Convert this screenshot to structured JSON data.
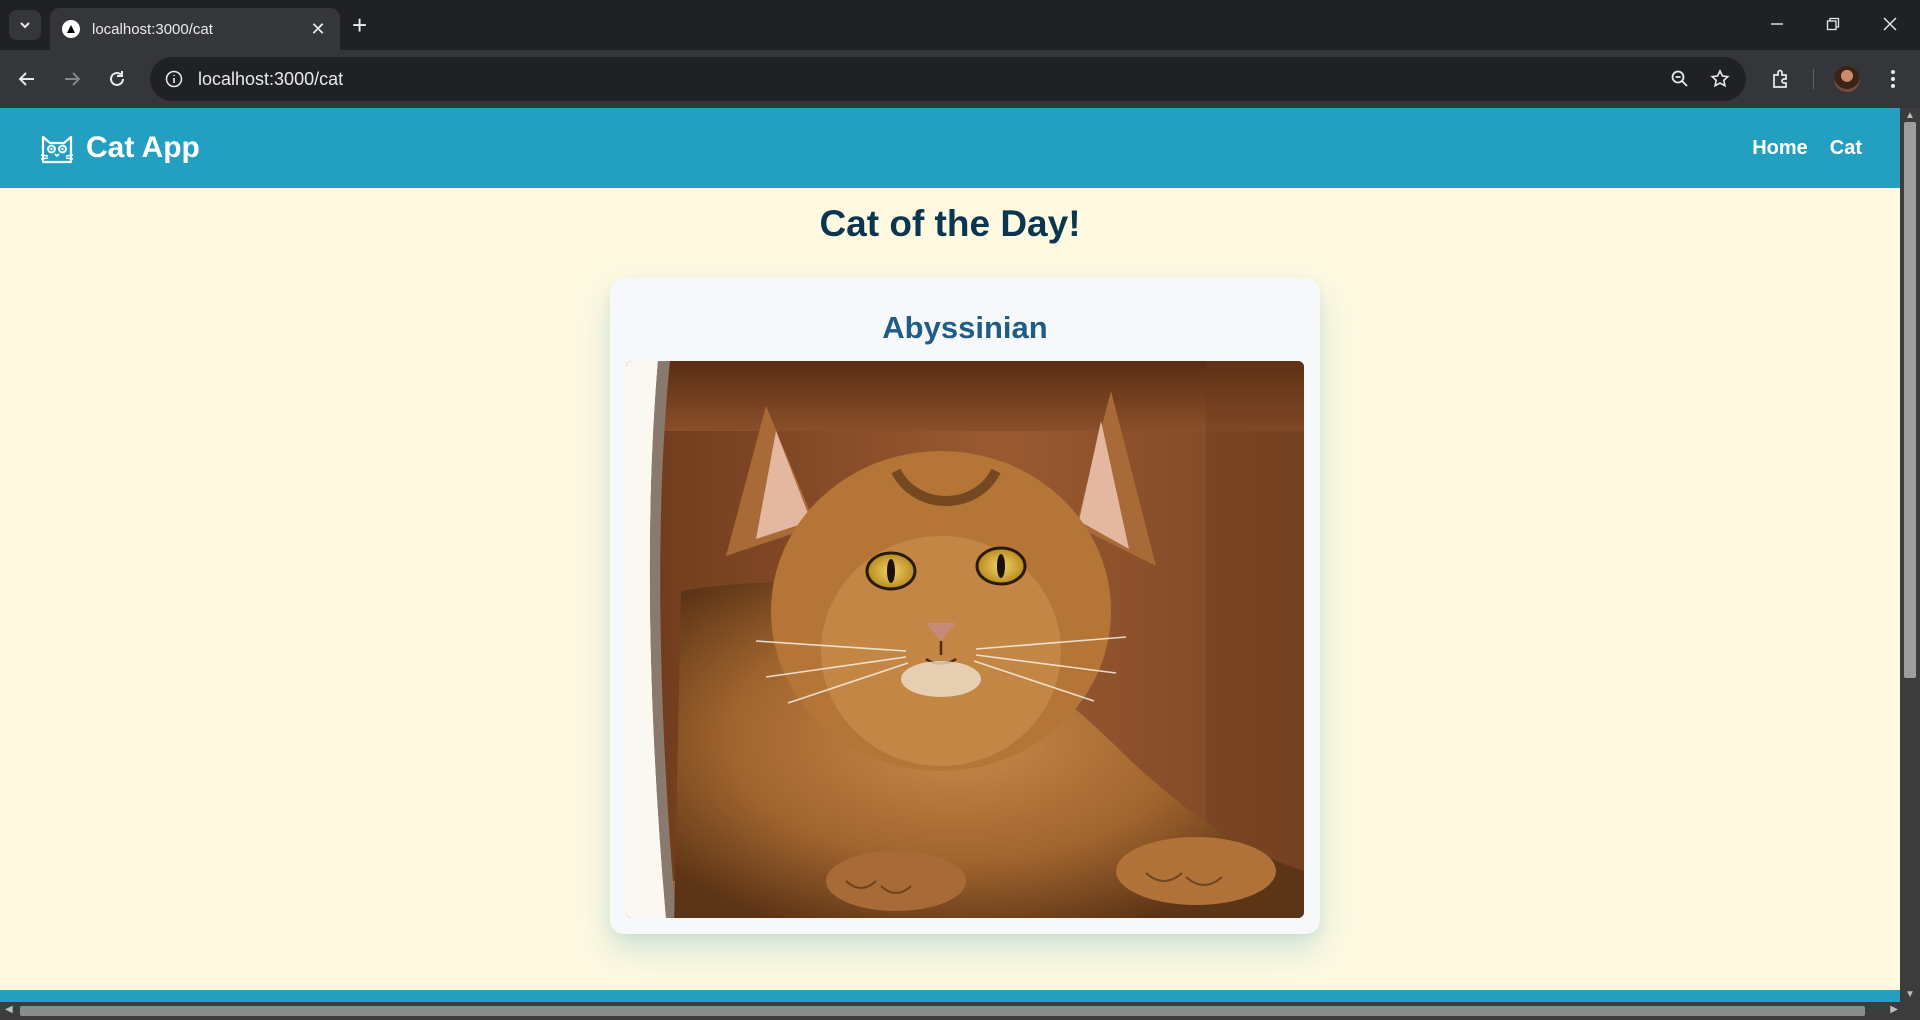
{
  "browser": {
    "tab_title": "localhost:3000/cat",
    "tab_close_glyph": "✕",
    "new_tab_glyph": "+",
    "url": "localhost:3000/cat",
    "icons": [
      "tab-search-icon",
      "back-icon",
      "forward-icon",
      "reload-icon",
      "site-info-icon",
      "zoom-icon",
      "bookmark-star-icon",
      "extensions-icon",
      "profile-avatar",
      "menu-icon",
      "minimize-icon",
      "restore-icon",
      "close-icon"
    ]
  },
  "app": {
    "brand": "Cat App",
    "brand_icon": "cat-face-icon",
    "nav": {
      "home": "Home",
      "cat": "Cat"
    },
    "colors": {
      "header": "#229fc1",
      "background": "#fff9e1",
      "title": "#0b3650",
      "card_title": "#1f5c86"
    }
  },
  "page": {
    "title": "Cat of the Day!",
    "card": {
      "breed": "Abyssinian",
      "image_alt": "Abyssinian cat lying in a cardboard box"
    }
  }
}
